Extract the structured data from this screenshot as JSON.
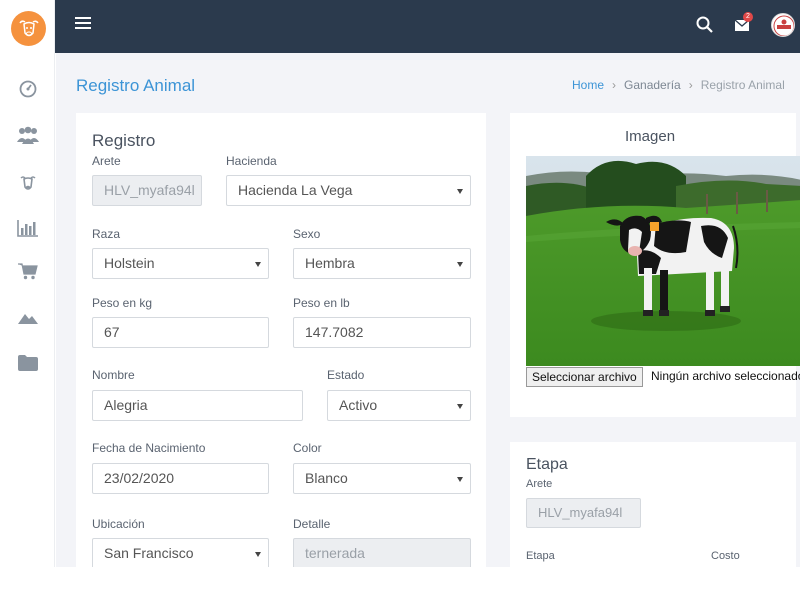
{
  "sidebar": {
    "items": [
      {
        "icon": "dashboard-icon"
      },
      {
        "icon": "users-icon"
      },
      {
        "icon": "cattle-icon"
      },
      {
        "icon": "chart-icon"
      },
      {
        "icon": "cart-icon"
      },
      {
        "icon": "mountain-icon"
      },
      {
        "icon": "folder-icon"
      }
    ]
  },
  "header": {
    "bg_color": "#2b3a4d",
    "mail_badge": "2"
  },
  "page": {
    "title": "Registro Animal",
    "breadcrumb": [
      "Home",
      "Ganadería",
      "Registro Animal"
    ]
  },
  "registro": {
    "title": "Registro",
    "arete": {
      "label": "Arete",
      "value": "HLV_myafa94l"
    },
    "hacienda": {
      "label": "Hacienda",
      "value": "Hacienda La Vega"
    },
    "raza": {
      "label": "Raza",
      "value": "Holstein"
    },
    "sexo": {
      "label": "Sexo",
      "value": "Hembra"
    },
    "peso_kg": {
      "label": "Peso en kg",
      "value": "67"
    },
    "peso_lb": {
      "label": "Peso en lb",
      "value": "147.7082"
    },
    "nombre": {
      "label": "Nombre",
      "value": "Alegria"
    },
    "estado": {
      "label": "Estado",
      "value": "Activo"
    },
    "fecha": {
      "label": "Fecha de Nacimiento",
      "value": "23/02/2020"
    },
    "color": {
      "label": "Color",
      "value": "Blanco"
    },
    "ubicacion": {
      "label": "Ubicación",
      "value": "San Francisco"
    },
    "detalle": {
      "label": "Detalle",
      "value": "ternerada"
    }
  },
  "imagen": {
    "title": "Imagen",
    "file_button": "Seleccionar archivo",
    "file_status": "Ningún archivo seleccionado"
  },
  "etapa": {
    "title": "Etapa",
    "arete": {
      "label": "Arete",
      "value": "HLV_myafa94l"
    },
    "etapa_label": "Etapa",
    "costo_label": "Costo"
  },
  "colors": {
    "accent": "#3c94d6",
    "logo": "#f5923e",
    "content_bg": "#f3f4f8"
  }
}
